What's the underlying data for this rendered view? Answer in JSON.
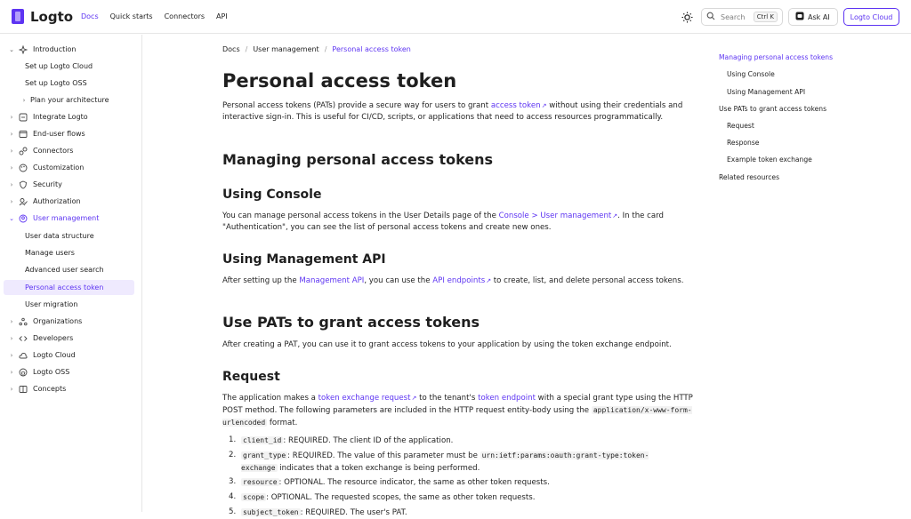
{
  "header": {
    "logo_text": "Logto",
    "nav": [
      "Docs",
      "Quick starts",
      "Connectors",
      "API"
    ],
    "search_placeholder": "Search",
    "search_shortcut": "Ctrl K",
    "ask_ai": "Ask AI",
    "cloud_button": "Logto Cloud",
    "accent": "#5d34f2"
  },
  "sidebar": {
    "items": [
      {
        "label": "Introduction",
        "icon": "sparkle-icon",
        "expanded": true
      },
      {
        "label": "Set up Logto Cloud"
      },
      {
        "label": "Set up Logto OSS"
      },
      {
        "label": "Plan your architecture"
      },
      {
        "label": "Integrate Logto",
        "icon": "integrate-icon"
      },
      {
        "label": "End-user flows",
        "icon": "browser-icon"
      },
      {
        "label": "Connectors",
        "icon": "connector-icon"
      },
      {
        "label": "Customization",
        "icon": "palette-icon"
      },
      {
        "label": "Security",
        "icon": "shield-icon"
      },
      {
        "label": "Authorization",
        "icon": "authorization-icon"
      },
      {
        "label": "User management",
        "icon": "user-circle-icon",
        "expanded": true
      },
      {
        "label": "User data structure"
      },
      {
        "label": "Manage users"
      },
      {
        "label": "Advanced user search"
      },
      {
        "label": "Personal access token",
        "active": true
      },
      {
        "label": "User migration"
      },
      {
        "label": "Organizations",
        "icon": "organization-icon"
      },
      {
        "label": "Developers",
        "icon": "code-icon"
      },
      {
        "label": "Logto Cloud",
        "icon": "cloud-icon"
      },
      {
        "label": "Logto OSS",
        "icon": "github-icon"
      },
      {
        "label": "Concepts",
        "icon": "book-icon"
      }
    ]
  },
  "breadcrumb": [
    "Docs",
    "User management",
    "Personal access token"
  ],
  "content": {
    "title": "Personal access token",
    "intro_1": "Personal access tokens (PATs) provide a secure way for users to grant ",
    "intro_link": "access token",
    "intro_2": " without using their credentials and interactive sign-in. This is useful for CI/CD, scripts, or applications that need to access resources programmatically.",
    "h_managing": "Managing personal access tokens",
    "h_console": "Using Console",
    "console_1": "You can manage personal access tokens in the User Details page of the ",
    "console_link": "Console > User management",
    "console_2": ". In the card \"Authentication\", you can see the list of personal access tokens and create new ones.",
    "h_mapi": "Using Management API",
    "mapi_1": "After setting up the ",
    "mapi_link1": "Management API",
    "mapi_2": ", you can use the ",
    "mapi_link2": "API endpoints",
    "mapi_3": " to create, list, and delete personal access tokens.",
    "h_use": "Use PATs to grant access tokens",
    "use_p": "After creating a PAT, you can use it to grant access tokens to your application by using the token exchange endpoint.",
    "h_request": "Request",
    "req_1": "The application makes a ",
    "req_link1": "token exchange request",
    "req_2": " to the tenant's ",
    "req_link2": "token endpoint",
    "req_3": " with a special grant type using the HTTP POST method. The following parameters are included in the HTTP request entity-body using the ",
    "req_code": "application/x-www-form-urlencoded",
    "req_4": " format.",
    "params": [
      {
        "num": "1.",
        "code": "client_id",
        "text": ": REQUIRED. The client ID of the application."
      },
      {
        "num": "2.",
        "code": "grant_type",
        "text": ": REQUIRED. The value of this parameter must be ",
        "code2": "urn:ietf:params:oauth:grant-type:token-exchange",
        "text2": " indicates that a token exchange is being performed."
      },
      {
        "num": "3.",
        "code": "resource",
        "text": ": OPTIONAL. The resource indicator, the same as other token requests."
      },
      {
        "num": "4.",
        "code": "scope",
        "text": ": OPTIONAL. The requested scopes, the same as other token requests."
      },
      {
        "num": "5.",
        "code": "subject_token",
        "text": ": REQUIRED. The user's PAT."
      }
    ]
  },
  "toc": [
    {
      "label": "Managing personal access tokens",
      "active": true
    },
    {
      "label": "Using Console"
    },
    {
      "label": "Using Management API"
    },
    {
      "label": "Use PATs to grant access tokens"
    },
    {
      "label": "Request"
    },
    {
      "label": "Response"
    },
    {
      "label": "Example token exchange"
    },
    {
      "label": "Related resources"
    }
  ]
}
